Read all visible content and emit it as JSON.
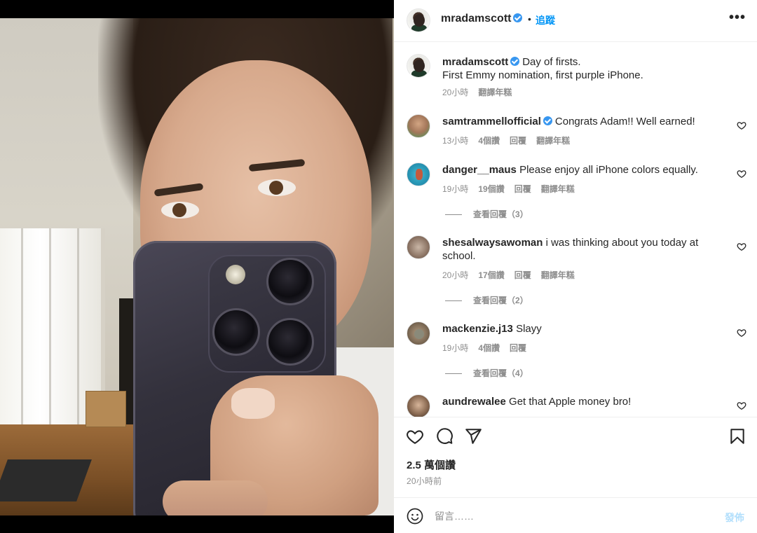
{
  "post": {
    "username": "mradamscott",
    "follow_dot": "•",
    "follow_label": "追蹤",
    "more_label": "•••"
  },
  "caption": {
    "username": "mradamscott",
    "line1": "Day of firsts.",
    "line2": "First Emmy nomination, first purple iPhone.",
    "time": "20小時",
    "translate": "翻譯年糕"
  },
  "comments": [
    {
      "username": "samtrammellofficial",
      "verified": true,
      "text": "Congrats Adam!! Well earned!",
      "time": "13小時",
      "likes": "4個讚",
      "reply": "回覆",
      "translate": "翻譯年糕"
    },
    {
      "username": "danger__maus",
      "verified": false,
      "text": "Please enjoy all iPhone colors equally.",
      "time": "19小時",
      "likes": "19個讚",
      "reply": "回覆",
      "translate": "翻譯年糕",
      "view_replies": "查看回覆（3）"
    },
    {
      "username": "shesalwaysawoman",
      "verified": false,
      "text_line1": "i was thinking about you today at",
      "text_line2": "school.",
      "time": "20小時",
      "likes": "17個讚",
      "reply": "回覆",
      "translate": "翻譯年糕",
      "view_replies": "查看回覆（2）"
    },
    {
      "username": "mackenzie.j13",
      "verified": false,
      "text": "Slayy",
      "time": "19小時",
      "likes": "4個讚",
      "reply": "回覆",
      "view_replies": "查看回覆（4）"
    },
    {
      "username": "aundrewalee",
      "verified": false,
      "text": "Get that Apple money bro!"
    }
  ],
  "stats": {
    "likes": "2.5 萬個讚",
    "posted_ago": "20小時前"
  },
  "composer": {
    "placeholder": "留言……",
    "post_label": "發佈"
  },
  "icons": {
    "like": "heart-icon",
    "comment": "comment-icon",
    "share": "paper-plane-icon",
    "save": "bookmark-icon",
    "emoji": "emoji-icon",
    "verified": "verified-badge-icon"
  },
  "colors": {
    "accent": "#0095f6",
    "verified": "#3897f0",
    "muted": "#8e8e8e",
    "post_disabled": "#b2dffc"
  }
}
